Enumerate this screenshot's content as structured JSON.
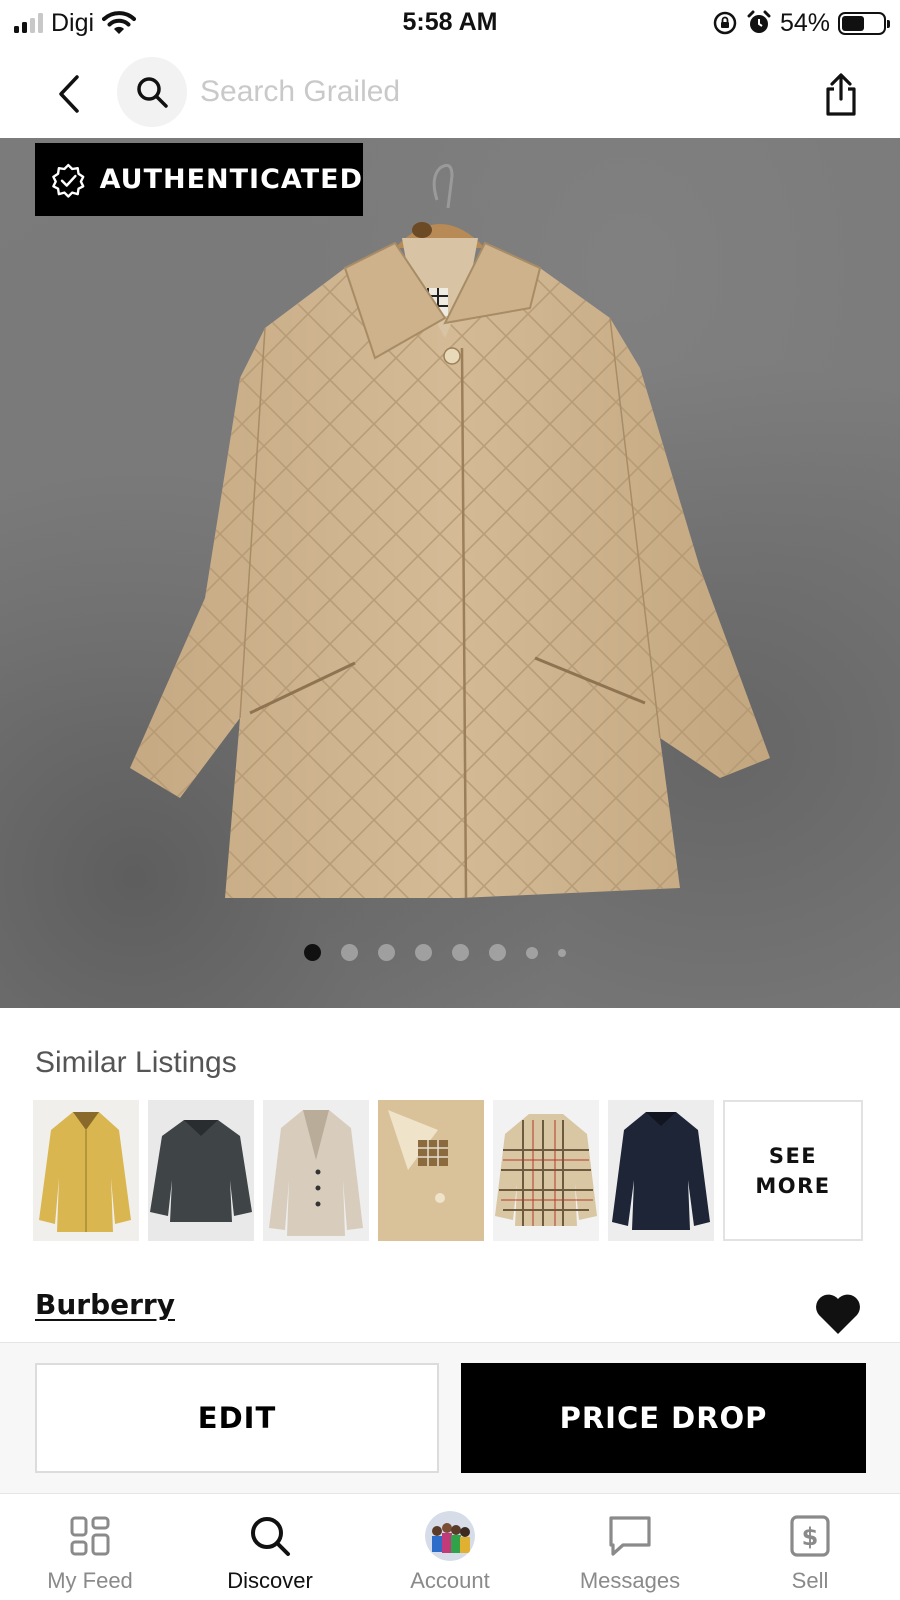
{
  "status_bar": {
    "carrier": "Digi",
    "time": "5:58 AM",
    "battery_percent": "54%",
    "battery_level": 0.54,
    "signal_bars_active": 2,
    "signal_bars_total": 4
  },
  "top_nav": {
    "search_placeholder": "Search Grailed",
    "back_icon": "chevron-left-icon",
    "search_icon": "search-icon",
    "share_icon": "share-icon"
  },
  "hero": {
    "badge_label": "AUTHENTICATED",
    "badge_icon": "verified-check-icon",
    "photo_count": 8,
    "active_photo_index": 0
  },
  "similar": {
    "title": "Similar Listings",
    "see_more_label": "SEE\nMORE",
    "thumbnails": [
      "yellow-jacket",
      "gray-jacket",
      "cream-blazer",
      "beige-coat",
      "plaid-shirt",
      "navy-jacket"
    ]
  },
  "listing": {
    "brand": "Burberry",
    "favorited": true
  },
  "actions": {
    "edit_label": "EDIT",
    "price_drop_label": "PRICE DROP"
  },
  "tabs": [
    {
      "label": "My Feed",
      "icon": "feed-grid-icon",
      "active": false
    },
    {
      "label": "Discover",
      "icon": "search-icon",
      "active": true
    },
    {
      "label": "Account",
      "icon": "avatar",
      "active": false
    },
    {
      "label": "Messages",
      "icon": "chat-bubble-icon",
      "active": false
    },
    {
      "label": "Sell",
      "icon": "dollar-tag-icon",
      "active": false
    }
  ],
  "colors": {
    "accent": "#000000",
    "inactive_tab": "#8a8a8a",
    "coat": "#cbb08a"
  }
}
